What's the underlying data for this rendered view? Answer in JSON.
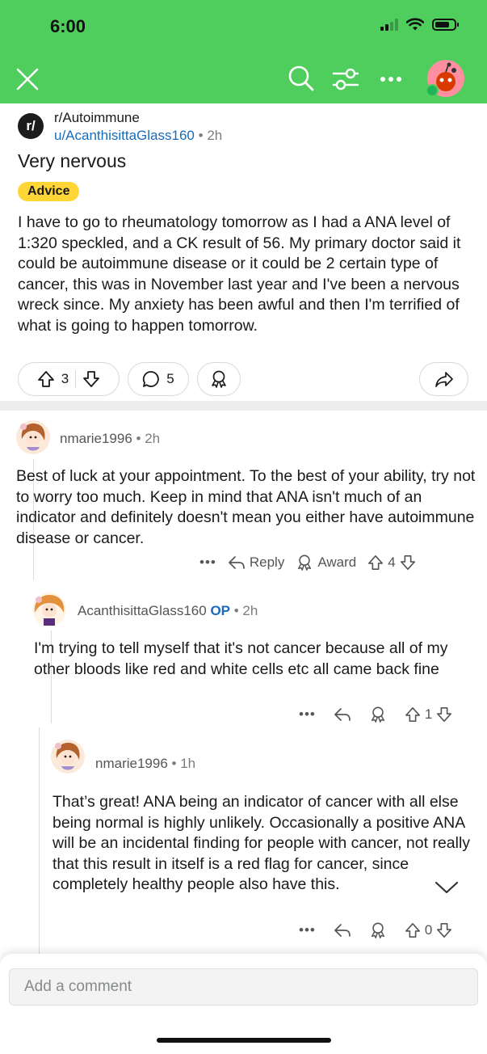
{
  "status_bar": {
    "time": "6:00",
    "battery_level": 0.75
  },
  "header": {
    "close_icon": "close-icon",
    "search_icon": "search-icon",
    "filter_icon": "filter-icon",
    "more_icon": "more-icon",
    "accent_color": "#4fce5d"
  },
  "post": {
    "subreddit_icon_text": "r/",
    "subreddit": "r/Autoimmune",
    "author": "u/AcanthisittaGlass160",
    "age": "2h",
    "title": "Very nervous",
    "flair": "Advice",
    "body": "I have to go to rheumatology tomorrow as I had a ANA level of 1:320 speckled, and a CK result of 56. My primary doctor said it could be autoimmune disease or it could be 2 certain type of cancer, this was in November last year and I've been a nervous wreck since. My anxiety has been awful and then I'm terrified of what is going to happen tomorrow.",
    "votes": "3",
    "comments": "5"
  },
  "comments": [
    {
      "author": "nmarie1996",
      "age": "2h",
      "body": "Best of luck at your appointment. To the best of your ability, try not to worry too much. Keep in mind that ANA isn't much of an indicator and definitely doesn't mean you either have autoimmune disease or cancer.",
      "reply_label": "Reply",
      "award_label": "Award",
      "votes": "4"
    },
    {
      "author": "AcanthisittaGlass160",
      "op_label": "OP",
      "age": "2h",
      "body": "I'm trying to tell myself that it's not cancer because all of my other bloods like red and white cells etc all came back fine",
      "votes": "1"
    },
    {
      "author": "nmarie1996",
      "age": "1h",
      "body": "That’s great! ANA being an indicator of cancer with all else being normal is highly unlikely. Occasionally a positive ANA will be an incidental finding for people with cancer, not really that this result in itself is a red flag for cancer, since completely healthy people also have this.",
      "votes": "0"
    }
  ],
  "comment_box": {
    "placeholder": "Add a comment"
  },
  "dot": "•",
  "more_dots": "•••"
}
